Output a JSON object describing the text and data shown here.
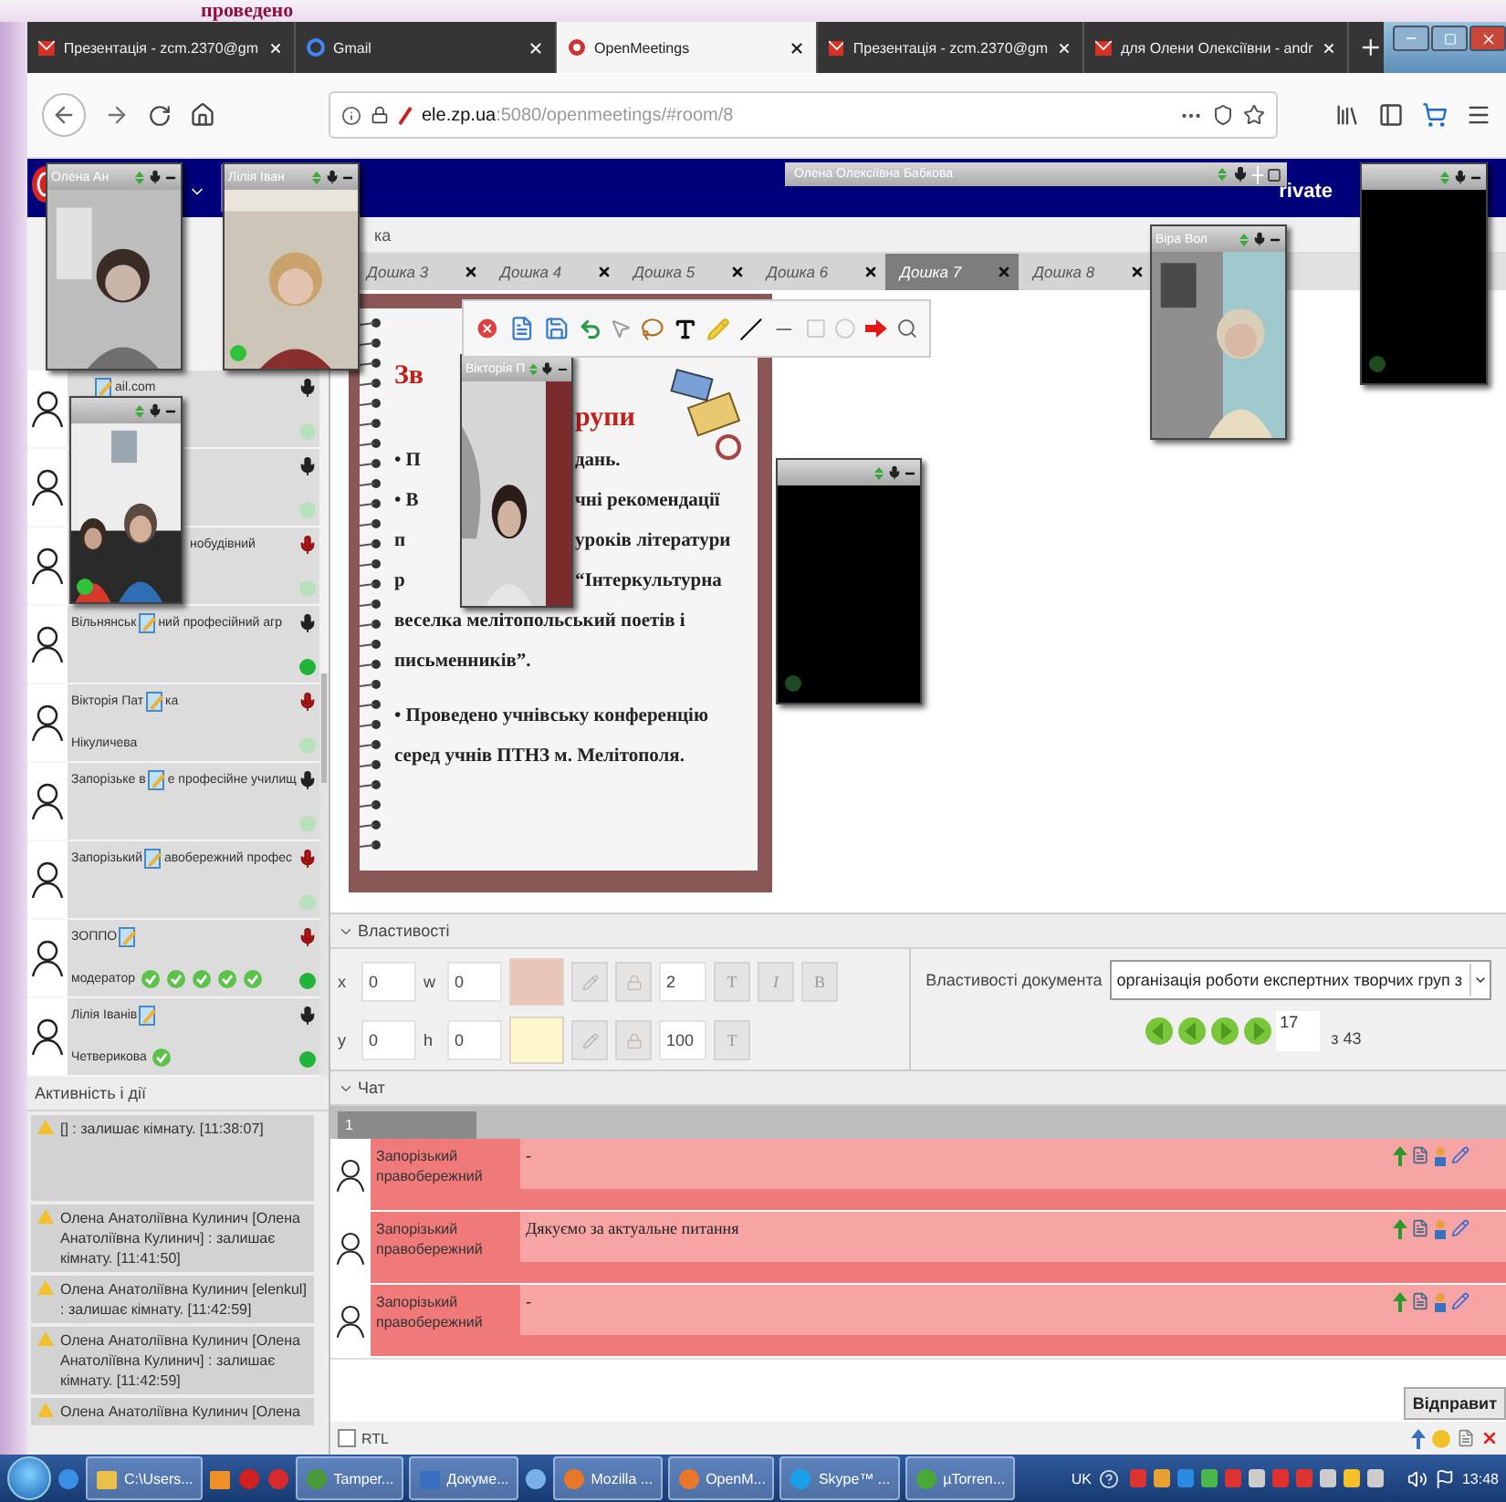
{
  "slide_title": "проведено",
  "browser": {
    "tabs": [
      {
        "title": "Презентація - zcm.2370@gm",
        "selected": false
      },
      {
        "title": "Gmail",
        "selected": false
      },
      {
        "title": "OpenMeetings",
        "selected": true
      },
      {
        "title": "Презентація - zcm.2370@gm",
        "selected": false
      },
      {
        "title": "для Олени Олексіївни - andr",
        "selected": false
      }
    ],
    "url": "**ele.zp.ua**:5080/openmeetings/#room/8"
  },
  "room": {
    "private_label": "rivate",
    "minimized_pod": "Олена Олексіївна Бабкова",
    "header": "ка",
    "video_pods": [
      {
        "name": "Олена Ан",
        "camera_on": true,
        "active": false
      },
      {
        "name": "Лілія Іван",
        "camera_on": true,
        "active": true
      },
      {
        "camera_on": true,
        "active": true
      },
      {
        "name": "Вікторія П",
        "camera_on": true,
        "active": false
      },
      {
        "camera_on": false
      },
      {
        "name": "Віра Вол",
        "camera_on": true,
        "active": false
      },
      {
        "camera_on": false
      }
    ],
    "boards": [
      {
        "label": "Дошка 3",
        "selected": false
      },
      {
        "label": "Дошка 4",
        "selected": false
      },
      {
        "label": "Дошка 5",
        "selected": false
      },
      {
        "label": "Дошка 6",
        "selected": false
      },
      {
        "label": "Дошка 7",
        "selected": true
      },
      {
        "label": "Дошка 8",
        "selected": false
      }
    ],
    "slide_lines": [
      {
        "kind": "title",
        "left": "Зв"
      },
      {
        "kind": "title",
        "right": "рупи"
      },
      {
        "kind": "body",
        "left": "• П",
        "right": "дань."
      },
      {
        "kind": "body",
        "left": "• В",
        "right": "чні рекомендації"
      },
      {
        "kind": "body",
        "left": "п",
        "right": "уроків літератури"
      },
      {
        "kind": "body",
        "left": "р",
        "right": "“Інтеркультурна"
      },
      {
        "kind": "body",
        "text": "веселка мелітопольський поетів і"
      },
      {
        "kind": "body",
        "text": "письменників”."
      },
      {
        "kind": "gap"
      },
      {
        "kind": "body",
        "text": "• Проведено учнівську конференцію"
      },
      {
        "kind": "body",
        "text": "серед учнів ПТНЗ м. Мелітополя."
      }
    ],
    "users": [
      {
        "tail": "ail.com",
        "pencil": true,
        "muted": false,
        "active": false
      },
      {
        "muted": false,
        "active": false
      },
      {
        "tail": "нобудівний",
        "muted": true,
        "active": false
      },
      {
        "lead": "Вільнянськ",
        "pencil": true,
        "tail": "ний професійний агр",
        "muted": false,
        "active": true
      },
      {
        "lead": "Вікторія Пат",
        "pencil": true,
        "tail": "ка",
        "sub": "Нікуличева",
        "muted": true,
        "active": false
      },
      {
        "lead": "Запорізьке в",
        "pencil": true,
        "tail": "е професійне училищ",
        "muted": false,
        "active": false
      },
      {
        "lead": "Запорізький",
        "pencil": true,
        "tail": "авобережний профес",
        "muted": true,
        "active": false
      },
      {
        "lead": "ЗОППО",
        "pencil": true,
        "sub": "модератор",
        "rights": [
          {
            "granted": true
          },
          {
            "granted": true
          },
          {
            "granted": true
          },
          {
            "granted": true
          },
          {
            "granted": true
          }
        ],
        "muted": true,
        "active": true
      },
      {
        "lead": "Лілія Іванів",
        "pencil": true,
        "sub": "Четверикова",
        "rights": [
          {
            "granted": true
          }
        ],
        "muted": false,
        "active": true
      }
    ],
    "activity": {
      "title": "Активність і дії",
      "entries": [
        "[] : залишає кімнату. [11:38:07]",
        "Олена Анатоліївна Кулинич [Олена Анатоліївна Кулинич] : залишає кімнату. [11:41:50]",
        "Олена Анатоліївна Кулинич [elenkul] : залишає кімнату. [11:42:59]",
        "Олена Анатоліївна Кулинич [Олена Анатоліївна Кулинич] : залишає кімнату. [11:42:59]",
        "Олена Анатоліївна Кулинич [Олена"
      ]
    },
    "properties": {
      "title": "Властивості",
      "rows": [
        {
          "fields": [
            {
              "label": "x",
              "value": "0"
            },
            {
              "label": "w",
              "value": "0"
            }
          ],
          "color": "#e8c6b8",
          "size": "2",
          "style_buttons": [
            "T",
            "I",
            "B"
          ]
        },
        {
          "fields": [
            {
              "label": "y",
              "value": "0"
            },
            {
              "label": "h",
              "value": "0"
            }
          ],
          "color": "#fff8cc",
          "size": "100",
          "style_buttons": [
            "T"
          ]
        }
      ],
      "document_label": "Властивості документа",
      "document": "організація роботи експертних творчих груп з",
      "page": "17",
      "page_total": "з 43"
    },
    "chat": {
      "title": "Чат",
      "tabs": [
        {
          "label": "1",
          "selected": true
        }
      ],
      "messages": [
        {
          "author": "Запорізький правобережний",
          "text": "-"
        },
        {
          "author": "Запорізький правобережний",
          "text": "Дякуємо за актуальне питання"
        },
        {
          "author": "Запорізький правобережний",
          "text": "-"
        }
      ],
      "send": "Відправит",
      "rtl": {
        "label": "RTL",
        "checked": false
      }
    }
  },
  "taskbar": {
    "tasks": [
      {
        "kind": "icon"
      },
      {
        "kind": "button",
        "label": "C:\\Users..."
      },
      {
        "kind": "icon"
      },
      {
        "kind": "icon"
      },
      {
        "kind": "icon"
      },
      {
        "kind": "button",
        "label": "Tamper..."
      },
      {
        "kind": "button",
        "label": "Докуме..."
      },
      {
        "kind": "icon"
      },
      {
        "kind": "button",
        "label": "Mozilla ..."
      },
      {
        "kind": "button",
        "label": "OpenM..."
      },
      {
        "kind": "button",
        "label": "Skype™ ..."
      },
      {
        "kind": "button",
        "label": "µTorren..."
      }
    ],
    "language": "UK",
    "clock": "13:48"
  }
}
